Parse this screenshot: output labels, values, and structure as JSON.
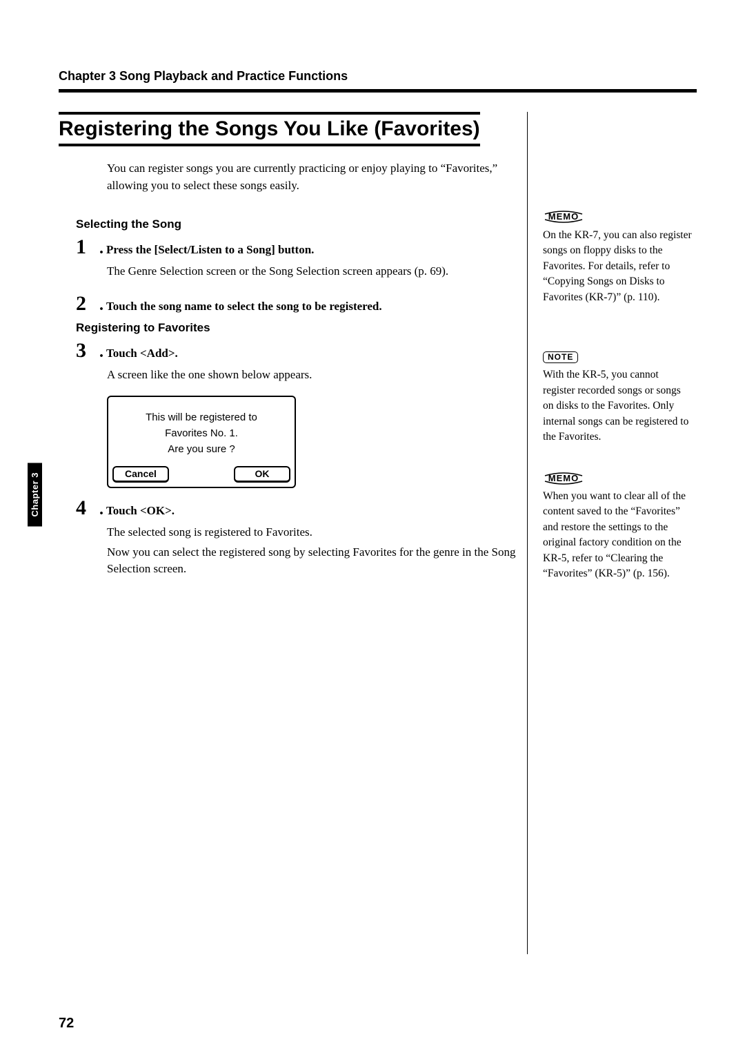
{
  "chapter_header": "Chapter 3 Song Playback and Practice Functions",
  "chapter_tab": "Chapter 3",
  "page_number": "72",
  "main_title": "Registering the Songs You Like (Favorites)",
  "intro": "You can register songs you are currently practicing or enjoy playing to “Favorites,” allowing you to select these songs easily.",
  "section1_heading": "Selecting the Song",
  "section2_heading": "Registering to Favorites",
  "steps": {
    "s1": {
      "num": "1",
      "dot": ".",
      "title": "Press the [Select/Listen to a Song] button.",
      "body": "The Genre Selection screen or the Song Selection screen appears (p. 69)."
    },
    "s2": {
      "num": "2",
      "dot": ".",
      "title": "Touch the song name to select the song to be registered."
    },
    "s3": {
      "num": "3",
      "dot": ".",
      "title": "Touch <Add>.",
      "body": "A screen like the one shown below appears."
    },
    "s4": {
      "num": "4",
      "dot": ".",
      "title": "Touch <OK>.",
      "body1": "The selected song is registered to Favorites.",
      "body2": "Now you can select the registered song by selecting Favorites for the genre in the Song Selection screen."
    }
  },
  "dialog": {
    "line1": "This will be registered to",
    "line2": "Favorites No. 1.",
    "line3": "Are you sure ?",
    "cancel": "Cancel",
    "ok": "OK"
  },
  "side": {
    "memo_label": "MEMO",
    "note_label": "NOTE",
    "memo1": "On the KR-7, you can also register songs on floppy disks to the Favorites. For details, refer to “Copying Songs on Disks to Favorites (KR-7)” (p. 110).",
    "note1": "With the KR-5, you cannot register recorded songs or songs on disks to the Favorites. Only internal songs can be registered to the Favorites.",
    "memo2": "When you want to clear all of the content saved to the “Favorites” and restore the settings to the original factory condition on the KR-5, refer to “Clearing the “Favorites” (KR-5)” (p. 156)."
  }
}
